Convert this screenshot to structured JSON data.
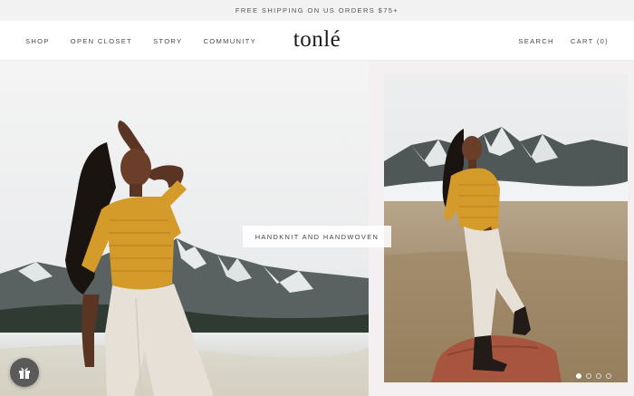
{
  "announcement": {
    "text": "FREE SHIPPING ON US ORDERS $75+"
  },
  "nav": {
    "left": [
      {
        "label": "SHOP"
      },
      {
        "label": "OPEN CLOSET"
      },
      {
        "label": "STORY"
      },
      {
        "label": "COMMUNITY"
      }
    ],
    "search_label": "SEARCH",
    "cart_label": "CART (0)"
  },
  "brand": {
    "logo_text": "tonlé"
  },
  "hero": {
    "caption": "HANDKNIT AND HANDWOVEN",
    "slides_total": 4,
    "active_slide": 1
  },
  "icons": {
    "gift": "gift-icon"
  },
  "colors": {
    "announcement_bg": "#f2f2f2",
    "sweater": "#d49a2a",
    "pants": "#e6e0d6",
    "mountain": "#545c5c",
    "snow": "#e9ecee"
  }
}
